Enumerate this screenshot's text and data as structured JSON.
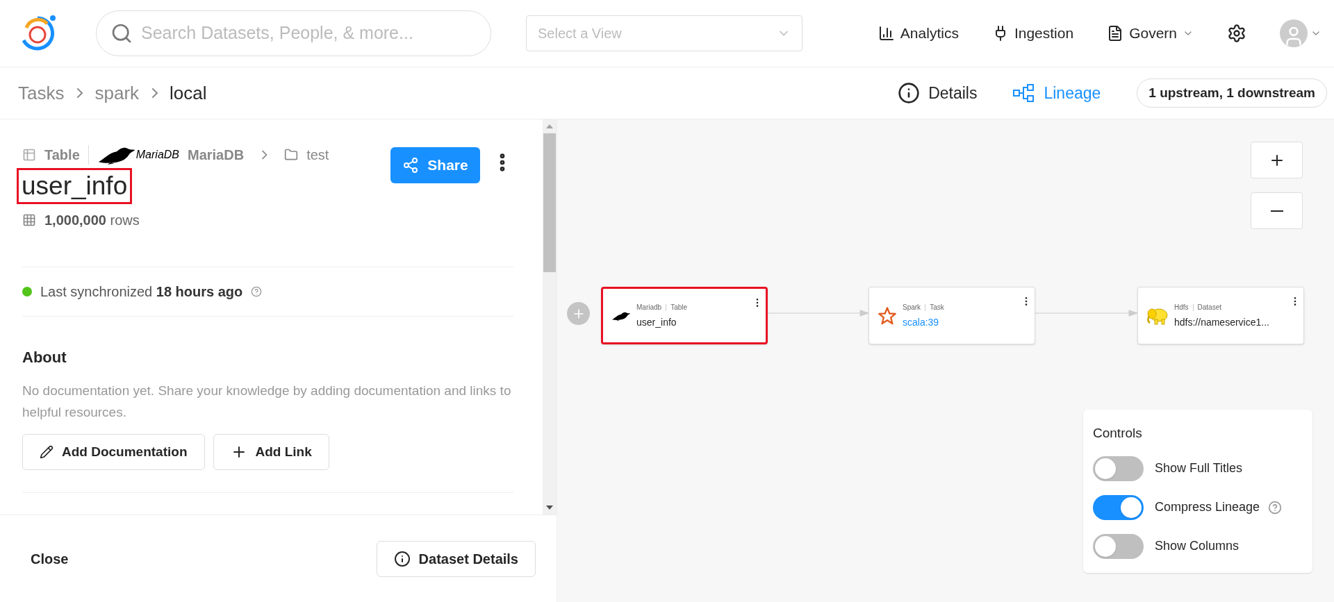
{
  "header": {
    "search": {
      "placeholder": "Search Datasets, People, & more..."
    },
    "view_select": {
      "placeholder": "Select a View"
    },
    "nav": [
      {
        "label": "Analytics",
        "kind": "chart",
        "dropdown": false
      },
      {
        "label": "Ingestion",
        "kind": "plug",
        "dropdown": false
      },
      {
        "label": "Govern",
        "kind": "doc",
        "dropdown": true
      }
    ]
  },
  "breadcrumb": [
    "Tasks",
    "spark",
    "local"
  ],
  "view_tabs": [
    {
      "label": "Details",
      "kind": "info",
      "selected": false
    },
    {
      "label": "Lineage",
      "kind": "lineage",
      "selected": true
    }
  ],
  "lineage_count": "1 upstream, 1 downstream",
  "entity": {
    "type": "Table",
    "platform_logo_text": "MariaDB",
    "platform": "MariaDB",
    "container": "test",
    "title": "user_info",
    "title_highlighted": true,
    "row_count": "1,000,000",
    "rows_label": "rows",
    "sync_prefix": "Last synchronized",
    "sync_time": "18 hours ago",
    "share": "Share",
    "about_title": "About",
    "about_text": "No documentation yet. Share your knowledge by adding documentation and links to helpful resources.",
    "actions": [
      {
        "label": "Add Documentation",
        "kind": "edit"
      },
      {
        "label": "Add Link",
        "kind": "plus"
      }
    ]
  },
  "footer": {
    "close": "Close",
    "details": "Dataset Details"
  },
  "nodes": [
    {
      "platform": "Mariadb",
      "type": "Table",
      "name": "user_info",
      "kind": "mariadb",
      "link": false,
      "highlighted": true
    },
    {
      "platform": "Spark",
      "type": "Task",
      "name": "scala:39",
      "kind": "spark",
      "link": true,
      "highlighted": false
    },
    {
      "platform": "Hdfs",
      "type": "Dataset",
      "name": "hdfs://nameservice1...",
      "kind": "hdfs",
      "link": false,
      "highlighted": false
    }
  ],
  "controls": {
    "title": "Controls",
    "toggles": [
      {
        "label": "Show Full Titles",
        "on": false,
        "help": false
      },
      {
        "label": "Compress Lineage",
        "on": true,
        "help": true
      },
      {
        "label": "Show Columns",
        "on": false,
        "help": false
      }
    ]
  }
}
